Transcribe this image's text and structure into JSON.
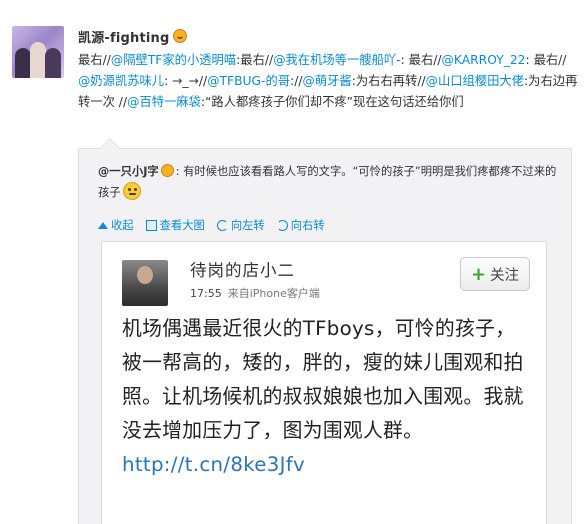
{
  "post": {
    "username": "凯源-fighting",
    "text_segments": [
      {
        "t": "最右//",
        "link": false
      },
      {
        "t": "@隔壁TF家的小透明喵",
        "link": true
      },
      {
        "t": ":最右//",
        "link": false
      },
      {
        "t": "@我在机场等一艘船吖-",
        "link": true
      },
      {
        "t": ": 最右//",
        "link": false
      },
      {
        "t": "@KARROY_22",
        "link": true
      },
      {
        "t": ": 最右//",
        "link": false
      },
      {
        "t": "@奶源凯苏味儿",
        "link": true
      },
      {
        "t": ": →_→//",
        "link": false
      },
      {
        "t": "@TFBUG-的哥",
        "link": true
      },
      {
        "t": "://",
        "link": false
      },
      {
        "t": "@萌牙酱",
        "link": true
      },
      {
        "t": ":为右右再转//",
        "link": false
      },
      {
        "t": "@山口组樱田大佬",
        "link": true
      },
      {
        "t": ":为右边再转一次 //",
        "link": false
      },
      {
        "t": "@百特一麻袋",
        "link": true
      },
      {
        "t": ":“路人都疼孩子你们却不疼”现在这句话还给你们",
        "link": false
      }
    ]
  },
  "forwarded": {
    "username": "@一只小J字",
    "text": ":  有时候也应该看看路人写的文字。“可怜的孩子”明明是我们疼都疼不过来的孩子",
    "actions": {
      "collapse": "收起",
      "zoom": "查看大图",
      "rotate_left": "向左转",
      "rotate_right": "向右转"
    }
  },
  "screenshot": {
    "name": "待岗的店小二",
    "time": "17:55",
    "source": "来自iPhone客户端",
    "follow_label": "关注",
    "body_text": "机场偶遇最近很火的TFboys，可怜的孩子，被一帮高的，矮的，胖的，瘦的妹儿围观和拍照。让机场候机的叔叔娘娘也加入围观。我就没去增加压力了，图为围观人群。",
    "url_text": "http://t.cn/8ke3Jfv"
  },
  "colors": {
    "link": "#0a8cd2",
    "forward_bg": "#f2f2f5",
    "follow_plus": "#3aa33a",
    "url": "#2a74b8"
  },
  "icons": [
    "crown-icon",
    "smile-icon",
    "collapse-icon",
    "zoom-icon",
    "rotate-left-icon",
    "rotate-right-icon",
    "plus-icon"
  ]
}
